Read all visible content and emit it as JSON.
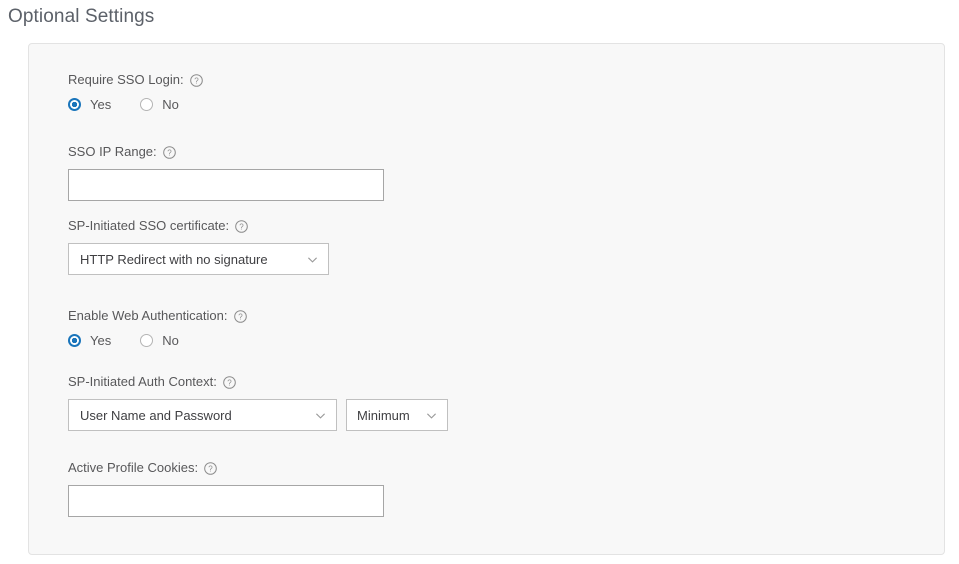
{
  "page": {
    "title": "Optional Settings"
  },
  "icons": {
    "help": "help-circle-icon",
    "chevron": "chevron-down-icon"
  },
  "colors": {
    "accent": "#1a75bb",
    "panel_background": "#f8f8f8",
    "panel_border": "#e3e3e3",
    "label_text": "#58585a",
    "title_text": "#5c6169",
    "input_border": "#a6a6a6",
    "select_border": "#c0c0c0"
  },
  "fields": {
    "require_sso_login": {
      "label": "Require SSO Login:",
      "options": [
        {
          "label": "Yes",
          "selected": true
        },
        {
          "label": "No",
          "selected": false
        }
      ]
    },
    "sso_ip_range": {
      "label": "SSO IP Range:",
      "value": "",
      "placeholder": ""
    },
    "sp_initiated_sso_certificate": {
      "label": "SP-Initiated SSO certificate:",
      "value": "HTTP Redirect with no signature"
    },
    "enable_web_authentication": {
      "label": "Enable Web Authentication:",
      "options": [
        {
          "label": "Yes",
          "selected": true
        },
        {
          "label": "No",
          "selected": false
        }
      ]
    },
    "sp_initiated_auth_context": {
      "label": "SP-Initiated Auth Context:",
      "value": "User Name and Password",
      "comparison_value": "Minimum"
    },
    "active_profile_cookies": {
      "label": "Active Profile Cookies:",
      "value": "",
      "placeholder": ""
    }
  }
}
